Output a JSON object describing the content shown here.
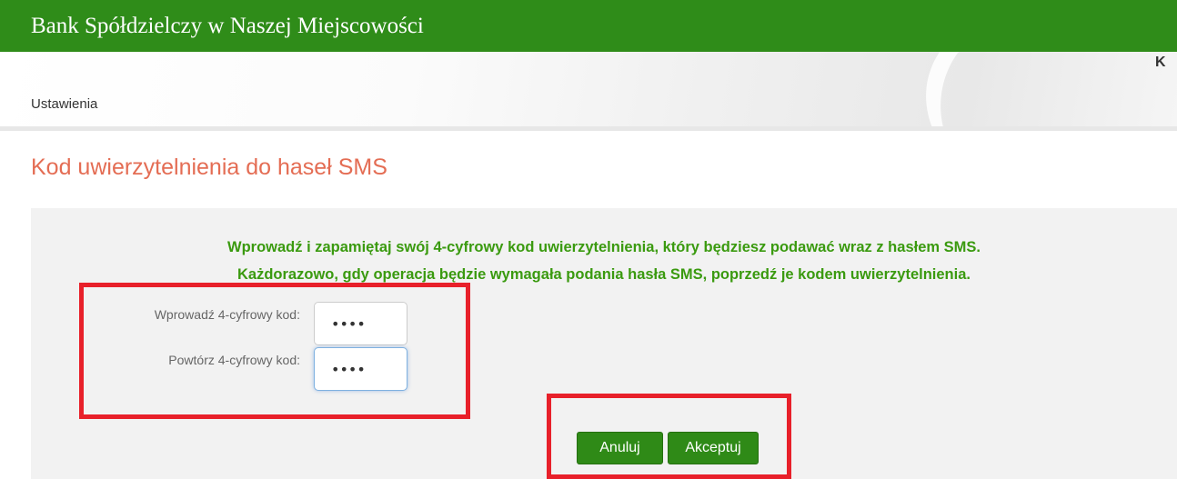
{
  "header": {
    "bank_name": "Bank Spółdzielczy w Naszej Miejscowości"
  },
  "banner": {
    "user_truncated": "K",
    "menu_item": "Ustawienia"
  },
  "page": {
    "title": "Kod uwierzytelnienia do haseł SMS"
  },
  "instruction": {
    "line1": "Wprowadź i zapamiętaj swój 4-cyfrowy kod uwierzytelnienia, który będziesz podawać wraz z hasłem SMS.",
    "line2": "Każdorazowo, gdy operacja będzie wymagała podania hasła SMS, poprzedź je kodem uwierzytelnienia."
  },
  "form": {
    "code_label": "Wprowadź 4-cyfrowy kod:",
    "code_value": "••••",
    "repeat_label": "Powtórz 4-cyfrowy kod:",
    "repeat_value": "••••"
  },
  "buttons": {
    "cancel": "Anuluj",
    "accept": "Akceptuj"
  },
  "colors": {
    "header_green": "#2f8c19",
    "title_orange": "#e46d54",
    "instruction_green": "#3a9a0f",
    "button_green": "#2f8a17",
    "highlight_red": "#e8202a"
  }
}
